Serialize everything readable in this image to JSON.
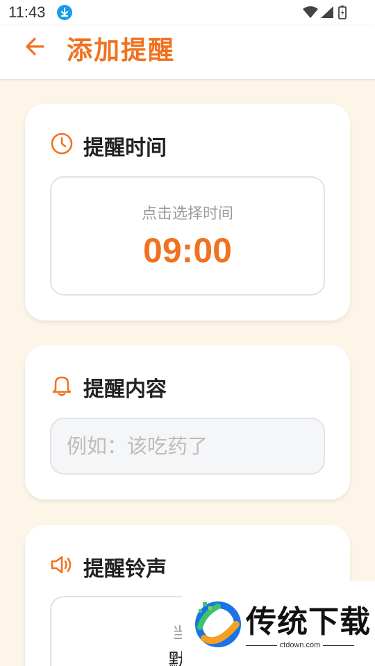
{
  "status_bar": {
    "time": "11:43"
  },
  "header": {
    "title": "添加提醒"
  },
  "time_card": {
    "title": "提醒时间",
    "hint": "点击选择时间",
    "value": "09:00"
  },
  "content_card": {
    "title": "提醒内容",
    "input_placeholder": "例如：该吃药了",
    "input_value": ""
  },
  "ringtone_card": {
    "title": "提醒铃声",
    "hint": "当前",
    "value": "默认"
  },
  "watermark": {
    "brand": "传统下载",
    "url": "ctdown.com"
  },
  "colors": {
    "accent": "#f07220",
    "background": "#fdf6e8",
    "card": "#ffffff"
  },
  "icons": [
    "back-arrow-icon",
    "clock-icon",
    "bell-icon",
    "speaker-icon",
    "download-icon",
    "wifi-icon",
    "signal-icon",
    "battery-icon"
  ]
}
